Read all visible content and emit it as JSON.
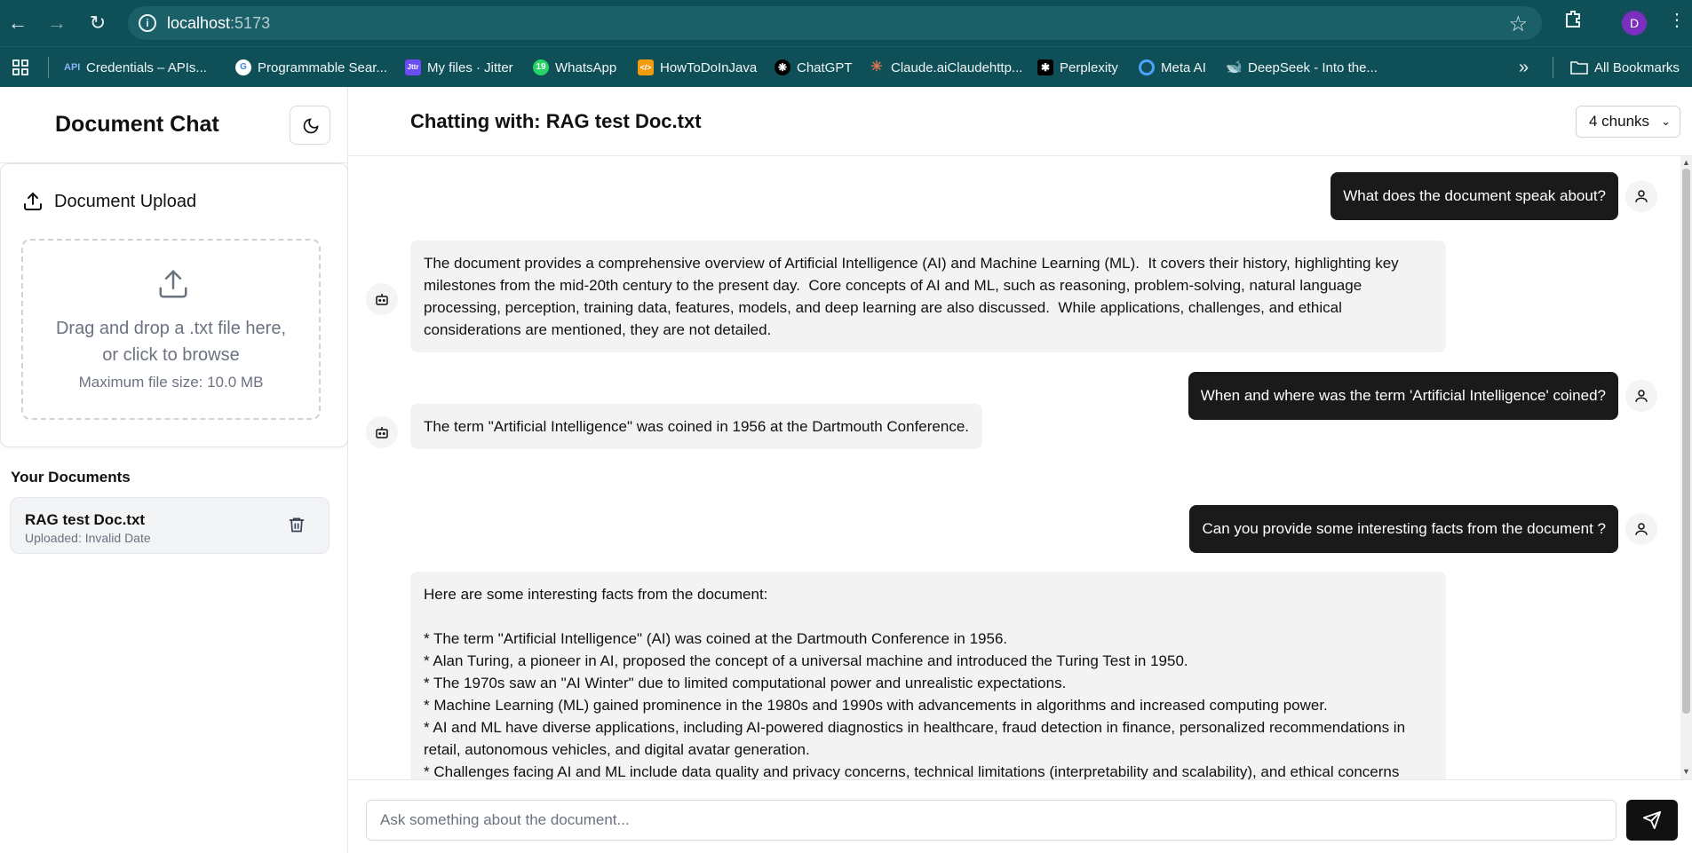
{
  "browser": {
    "url_host": "localhost",
    "url_port": ":5173",
    "profile_initial": "D",
    "bookmarks": [
      {
        "label": "Credentials – APIs...",
        "icon": "api-icon"
      },
      {
        "label": "Programmable Sear...",
        "icon": "google-icon"
      },
      {
        "label": "My files · Jitter",
        "icon": "jitter-icon"
      },
      {
        "label": "WhatsApp",
        "icon": "whatsapp-icon"
      },
      {
        "label": "HowToDoInJava",
        "icon": "howtodoinjava-icon"
      },
      {
        "label": "ChatGPT",
        "icon": "chatgpt-icon"
      },
      {
        "label": "Claude.aiClaudehttp...",
        "icon": "claude-icon"
      },
      {
        "label": "Perplexity",
        "icon": "perplexity-icon"
      },
      {
        "label": "Meta AI",
        "icon": "meta-ai-icon"
      },
      {
        "label": "DeepSeek - Into the...",
        "icon": "deepseek-icon"
      }
    ],
    "more_bookmarks": "»",
    "all_bookmarks": "All Bookmarks"
  },
  "sidebar": {
    "title": "Document Chat",
    "upload": {
      "title": "Document Upload",
      "drop_text_1": "Drag and drop a .txt file here,",
      "drop_text_2": "or click to browse",
      "max_size": "Maximum file size: 10.0 MB"
    },
    "documents_title": "Your Documents",
    "documents": [
      {
        "name": "RAG test Doc.txt",
        "uploaded": "Uploaded: Invalid Date"
      }
    ]
  },
  "chat": {
    "title": "Chatting with: RAG test Doc.txt",
    "chunks_selected": "4 chunks",
    "messages": [
      {
        "role": "user",
        "text": "What does the document speak about?"
      },
      {
        "role": "bot",
        "lines": [
          "The document provides a comprehensive overview of Artificial Intelligence (AI) and Machine Learning (ML).  It covers their history, highlighting key",
          "milestones from the mid-20th century to the present day.  Core concepts of AI and ML, such as reasoning, problem-solving, natural language",
          "processing, perception, training data, features, models, and deep learning are also discussed.  While applications, challenges, and ethical",
          "considerations are mentioned, they are not detailed."
        ]
      },
      {
        "role": "user",
        "text": "When and where was the term 'Artificial Intelligence' coined?"
      },
      {
        "role": "bot",
        "lines": [
          "The term \"Artificial Intelligence\" was coined in 1956 at the Dartmouth Conference."
        ]
      },
      {
        "role": "user",
        "text": "Can you provide some interesting facts from the document ?"
      },
      {
        "role": "bot",
        "lines": [
          "Here are some interesting facts from the document:",
          "",
          "* The term \"Artificial Intelligence\" (AI) was coined at the Dartmouth Conference in 1956.",
          "* Alan Turing, a pioneer in AI, proposed the concept of a universal machine and introduced the Turing Test in 1950.",
          "* The 1970s saw an \"AI Winter\" due to limited computational power and unrealistic expectations.",
          "* Machine Learning (ML) gained prominence in the 1980s and 1990s with advancements in algorithms and increased computing power.",
          "* AI and ML have diverse applications, including AI-powered diagnostics in healthcare, fraud detection in finance, personalized recommendations in",
          "retail, autonomous vehicles, and digital avatar generation.",
          "* Challenges facing AI and ML include data quality and privacy concerns, technical limitations (interpretability and scalability), and ethical concerns"
        ]
      }
    ],
    "input_placeholder": "Ask something about the document..."
  }
}
